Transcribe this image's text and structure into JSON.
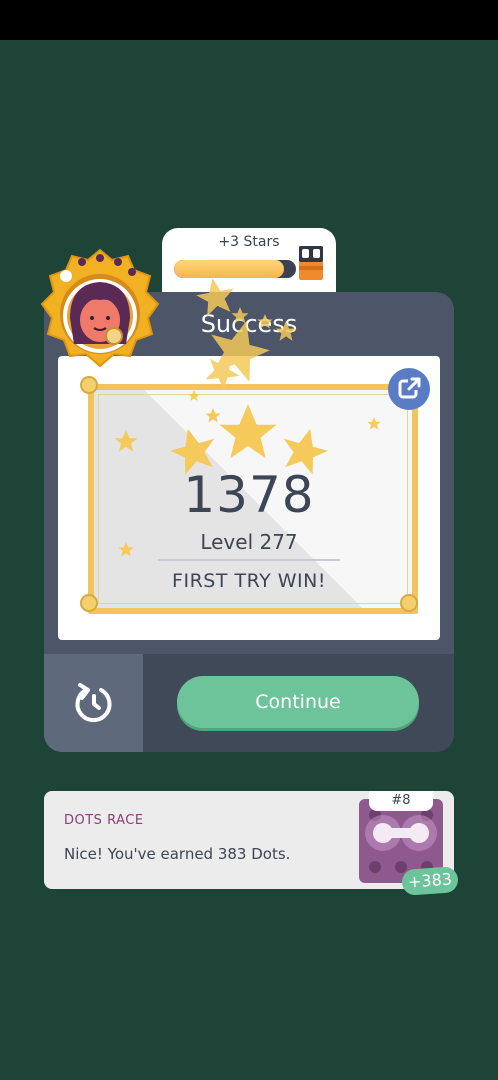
{
  "stars_reward": {
    "label": "+3 Stars",
    "progress": 0.9
  },
  "result": {
    "title": "Success",
    "score": "1378",
    "level": "Level 277",
    "subtitle": "FIRST TRY WIN!"
  },
  "actions": {
    "continue_label": "Continue"
  },
  "dots_race": {
    "title": "DOTS RACE",
    "message": "Nice! You've earned 383 Dots.",
    "rank": "#8",
    "earned": "+383"
  },
  "colors": {
    "background": "#1e4337",
    "card": "#4c5668",
    "accent_green": "#6ec49a",
    "gold": "#f0c55b",
    "race_title": "#8a3e7a"
  },
  "icons": [
    "treasure-chest-icon",
    "share-icon",
    "replay-icon",
    "avatar-badge-icon",
    "star-icon",
    "dots-puzzle-icon"
  ]
}
